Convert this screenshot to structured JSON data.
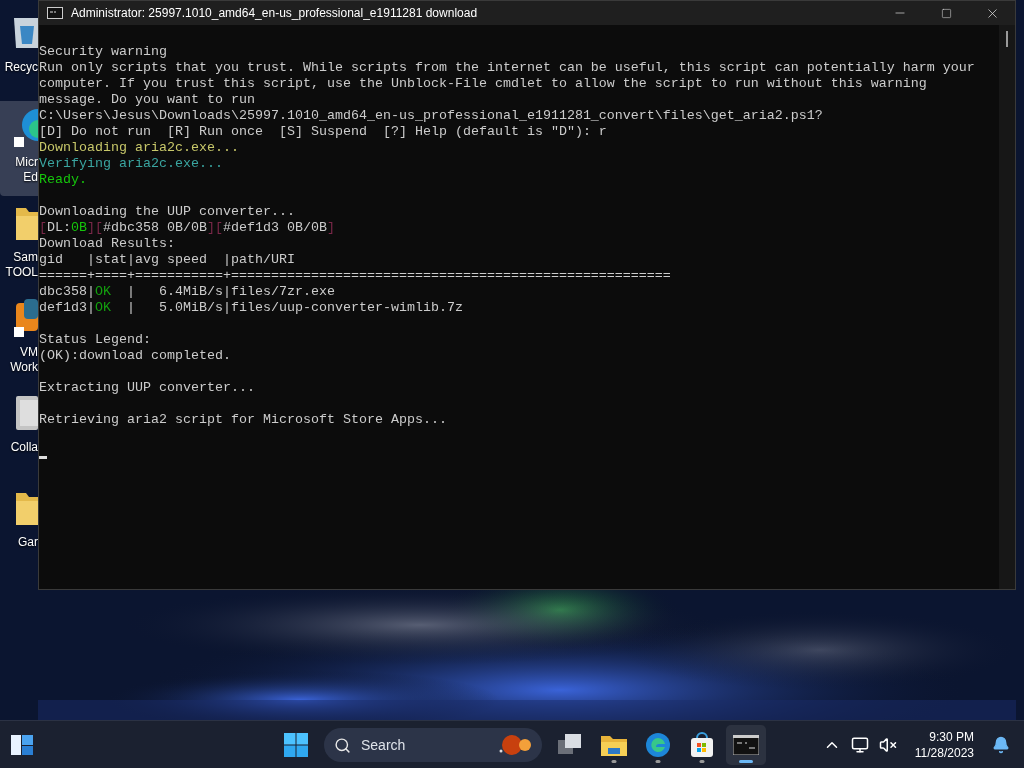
{
  "desktop_icons": [
    {
      "label": [
        "Recyc"
      ],
      "kind": "recycle",
      "selected": false
    },
    {
      "label": [
        "Micr",
        "Ed"
      ],
      "kind": "edge",
      "selected": true
    },
    {
      "label": [
        "Sam",
        "TOOL"
      ],
      "kind": "folder",
      "selected": false
    },
    {
      "label": [
        "VM",
        "Work"
      ],
      "kind": "vm",
      "selected": false
    },
    {
      "label": [
        "Colla"
      ],
      "kind": "book",
      "selected": false
    },
    {
      "label": [
        "Gar"
      ],
      "kind": "folder",
      "selected": false
    }
  ],
  "window": {
    "title": "Administrator:  25997.1010_amd64_en-us_professional_e1911281 download"
  },
  "console": {
    "lines": [
      {
        "kind": "text",
        "segments": [
          {
            "text": "Security warning",
            "color": "#cccccc"
          }
        ]
      },
      {
        "kind": "text",
        "segments": [
          {
            "text": "Run only scripts that you trust. While scripts from the internet can be useful, this script can potentially harm your",
            "color": "#cccccc"
          }
        ]
      },
      {
        "kind": "text",
        "segments": [
          {
            "text": "computer. If you trust this script, use the Unblock-File cmdlet to allow the script to run without this warning",
            "color": "#cccccc"
          }
        ]
      },
      {
        "kind": "text",
        "segments": [
          {
            "text": "message. Do you want to run",
            "color": "#cccccc"
          }
        ]
      },
      {
        "kind": "text",
        "segments": [
          {
            "text": "C:\\Users\\Jesus\\Downloads\\25997.1010_amd64_en-us_professional_e1911281_convert\\files\\get_aria2.ps1?",
            "color": "#cccccc"
          }
        ]
      },
      {
        "kind": "text",
        "segments": [
          {
            "text": "[D] Do not run  [R] Run once  [S] Suspend  [?] Help (default is \"D\"): r",
            "color": "#cccccc"
          }
        ]
      },
      {
        "kind": "text",
        "segments": [
          {
            "text": "Downloading aria2c.exe...",
            "color": "#c8c86a"
          }
        ]
      },
      {
        "kind": "text",
        "segments": [
          {
            "text": "Verifying aria2c.exe...",
            "color": "#3aa5a0"
          }
        ]
      },
      {
        "kind": "text",
        "segments": [
          {
            "text": "Ready.",
            "color": "#16c60c"
          }
        ]
      },
      {
        "kind": "blank"
      },
      {
        "kind": "text",
        "segments": [
          {
            "text": "Downloading the UUP converter...",
            "color": "#cccccc"
          }
        ]
      },
      {
        "kind": "text",
        "segments": [
          {
            "text": "[",
            "color": "#7a2848"
          },
          {
            "text": "DL:",
            "color": "#cccccc"
          },
          {
            "text": "0B",
            "color": "#16c60c"
          },
          {
            "text": "][",
            "color": "#7a2848"
          },
          {
            "text": "#dbc358 0B/0B",
            "color": "#cccccc"
          },
          {
            "text": "][",
            "color": "#7a2848"
          },
          {
            "text": "#def1d3 0B/0B",
            "color": "#cccccc"
          },
          {
            "text": "]",
            "color": "#7a2848"
          }
        ]
      },
      {
        "kind": "text",
        "segments": [
          {
            "text": "Download Results:",
            "color": "#cccccc"
          }
        ]
      },
      {
        "kind": "text",
        "segments": [
          {
            "text": "gid   |stat|avg speed  |path/URI",
            "color": "#cccccc"
          }
        ]
      },
      {
        "kind": "text",
        "segments": [
          {
            "text": "======+====+===========+=======================================================",
            "color": "#cccccc"
          }
        ]
      },
      {
        "kind": "text",
        "segments": [
          {
            "text": "dbc358|",
            "color": "#cccccc"
          },
          {
            "text": "OK",
            "color": "#13a10e"
          },
          {
            "text": "  |   6.4MiB/s|files/7zr.exe",
            "color": "#cccccc"
          }
        ]
      },
      {
        "kind": "text",
        "segments": [
          {
            "text": "def1d3|",
            "color": "#cccccc"
          },
          {
            "text": "OK",
            "color": "#13a10e"
          },
          {
            "text": "  |   5.0MiB/s|files/uup-converter-wimlib.7z",
            "color": "#cccccc"
          }
        ]
      },
      {
        "kind": "blank"
      },
      {
        "kind": "text",
        "segments": [
          {
            "text": "Status Legend:",
            "color": "#cccccc"
          }
        ]
      },
      {
        "kind": "text",
        "segments": [
          {
            "text": "(OK):download completed.",
            "color": "#cccccc"
          }
        ]
      },
      {
        "kind": "blank"
      },
      {
        "kind": "text",
        "segments": [
          {
            "text": "Extracting UUP converter...",
            "color": "#cccccc"
          }
        ]
      },
      {
        "kind": "blank"
      },
      {
        "kind": "text",
        "segments": [
          {
            "text": "Retrieving aria2 script for Microsoft Store Apps...",
            "color": "#cccccc"
          }
        ]
      },
      {
        "kind": "blank"
      },
      {
        "kind": "cursor"
      }
    ]
  },
  "taskbar": {
    "search": {
      "placeholder": "Search"
    },
    "apps": [
      {
        "kind": "task-view",
        "selected": false
      },
      {
        "kind": "explorer",
        "selected": false
      },
      {
        "kind": "edge",
        "selected": false
      },
      {
        "kind": "store",
        "selected": false
      },
      {
        "kind": "terminal",
        "selected": true
      }
    ],
    "clock": {
      "time": "9:30 PM",
      "date": "11/28/2023"
    }
  }
}
